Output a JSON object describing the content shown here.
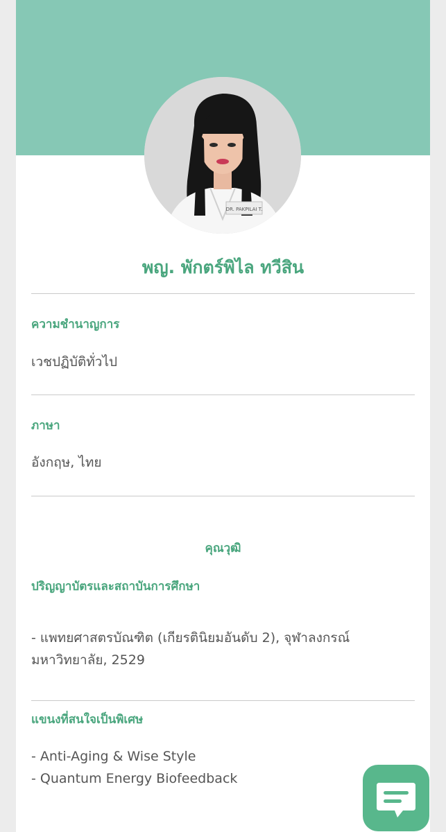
{
  "profile": {
    "name": "พญ. พักตร์พิไล ทวีสิน",
    "photo_badge": "DR. PAKPILAI T."
  },
  "specialty": {
    "label": "ความชำนาญการ",
    "value": "เวชปฏิบัติทั่วไป"
  },
  "language": {
    "label": "ภาษา",
    "value": "อังกฤษ, ไทย"
  },
  "qualifications": {
    "heading": "คุณวุฒิ",
    "education_label": "ปริญญาบัตรและสถาบันการศึกษา",
    "education_lines": [
      "- แพทยศาสตรบัณฑิต (เกียรตินิยมอันดับ 2), จุฬาลงกรณ์",
      "มหาวิทยาลัย, 2529"
    ],
    "interests_label": "แขนงที่สนใจเป็นพิเศษ",
    "interests": [
      "- Anti-Aging & Wise Style",
      "- Quantum Energy Biofeedback"
    ]
  },
  "colors": {
    "banner": "#86c8b5",
    "accent": "#4aa67e",
    "chat_button": "#58b78c"
  },
  "icons": {
    "chat": "chat-bubble-icon"
  }
}
